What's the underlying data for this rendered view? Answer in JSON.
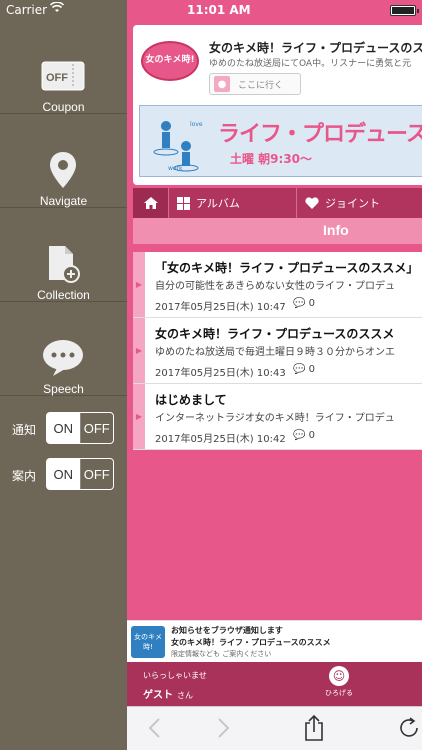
{
  "statusbar": {
    "carrier": "Carrier",
    "time": "11:01 AM"
  },
  "sidebar": {
    "items": [
      {
        "label": "Coupon",
        "icon": "coupon-icon",
        "icon_text": "OFF"
      },
      {
        "label": "Navigate",
        "icon": "location-pin-icon"
      },
      {
        "label": "Collection",
        "icon": "add-document-icon"
      },
      {
        "label": "Speech",
        "icon": "speech-bubble-icon"
      }
    ],
    "toggles": [
      {
        "label": "通知",
        "on": "ON",
        "off": "OFF",
        "state": "OFF"
      },
      {
        "label": "案内",
        "on": "ON",
        "off": "OFF",
        "state": "OFF"
      }
    ]
  },
  "header_card": {
    "logo_text": "女のキメ時!",
    "title": "女のキメ時！ライフ・プロデュースのススメ",
    "subtitle": "ゆめのたね放送局にてOA中。リスナーに勇気と元",
    "go_button": "ここに行く",
    "banner_title": "ライフ・プロデュースのススメ",
    "banner_time": "土曜 朝9:30〜",
    "banner_love": "love",
    "banner_work": "work"
  },
  "tabs": [
    {
      "label": "",
      "icon": "home-icon"
    },
    {
      "label": "アルバム",
      "icon": "grid-icon"
    },
    {
      "label": "ジョイント",
      "icon": "heart-icon"
    }
  ],
  "info_title": "Info",
  "posts": [
    {
      "title": "「女のキメ時！ライフ・プロデュースのススメ」",
      "body": "自分の可能性をあきらめない女性のライフ・プロデュ",
      "date": "2017年05月25日(木) 10:47",
      "comments": "0"
    },
    {
      "title": "女のキメ時！ライフ・プロデュースのススメ",
      "body": "ゆめのたね放送局で毎週土曜日９時３０分からオンエ",
      "date": "2017年05月25日(木) 10:43",
      "comments": "0"
    },
    {
      "title": "はじめまして",
      "body": "インターネットラジオ女のキメ時！ライフ・プロデュ",
      "date": "2017年05月25日(木) 10:42",
      "comments": "0"
    }
  ],
  "notice": {
    "logo_text": "女のキメ時!",
    "line1": "お知らせをブラウザ通知します",
    "line2": "女のキメ時！ライフ・プロデュースのススメ",
    "line3": "限定情報なども ご案内ください"
  },
  "guest": {
    "greeting": "いらっしゃいませ",
    "name": "ゲスト",
    "suffix": "さん",
    "expand_label": "ひろげる"
  },
  "colors": {
    "accent": "#e8578a",
    "sidebar": "#6e6656",
    "tabbar": "#b0345e"
  }
}
